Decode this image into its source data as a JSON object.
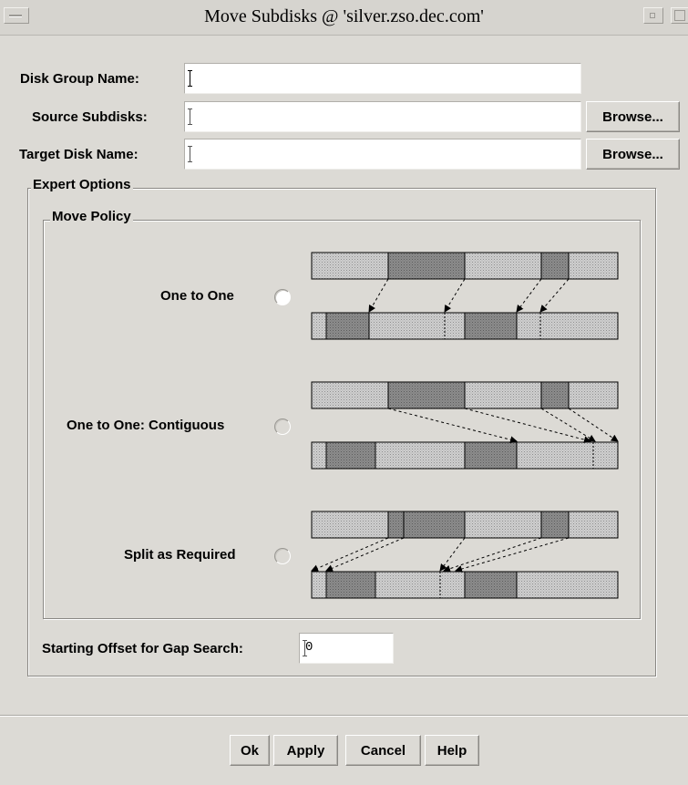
{
  "window": {
    "title": "Move Subdisks @ 'silver.zso.dec.com'"
  },
  "form": {
    "disk_group_label": "Disk Group Name:",
    "disk_group_value": "",
    "source_label": "Source Subdisks:",
    "source_value": "",
    "target_label": "Target Disk Name:",
    "target_value": "",
    "browse_label": "Browse..."
  },
  "expert": {
    "title": "Expert Options",
    "move_policy_title": "Move Policy",
    "options": [
      {
        "label": "One to One",
        "selected": false,
        "icon": "radio-button"
      },
      {
        "label": "One to One: Contiguous",
        "selected": false,
        "icon": "radio-button"
      },
      {
        "label": "Split as Required",
        "selected": false,
        "icon": "radio-button"
      }
    ],
    "offset_label": "Starting Offset for Gap Search:",
    "offset_value": "0"
  },
  "buttons": {
    "ok": "Ok",
    "apply": "Apply",
    "cancel": "Cancel",
    "help": "Help"
  },
  "colors": {
    "background": "#dcdad5",
    "free_segment": "#c6c6c6",
    "used_segment": "#8e8e8e",
    "field": "#ffffff"
  }
}
